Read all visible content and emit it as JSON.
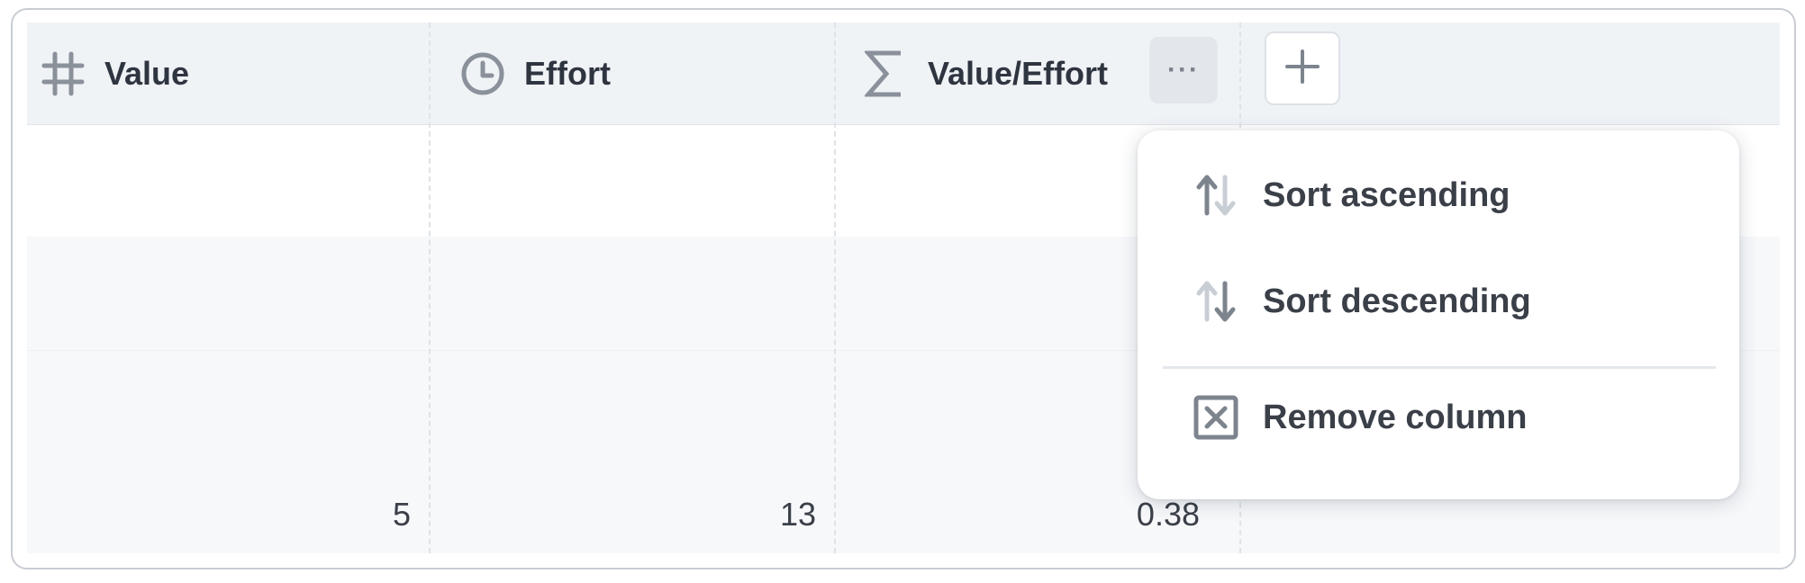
{
  "columns": [
    {
      "icon": "hash-icon",
      "label": "Value"
    },
    {
      "icon": "clock-icon",
      "label": "Effort"
    },
    {
      "icon": "sigma-icon",
      "label": "Value/Effort"
    }
  ],
  "header_actions": {
    "more_label": "···",
    "add_icon": "plus-icon"
  },
  "rows": [
    {
      "value": "",
      "effort": "",
      "ratio": ""
    },
    {
      "value": "",
      "effort": "",
      "ratio": ""
    },
    {
      "value": "",
      "effort": "",
      "ratio": ""
    },
    {
      "value": "5",
      "effort": "13",
      "ratio": "0.38"
    }
  ],
  "column_menu": {
    "items": [
      {
        "icon": "sort-ascending-icon",
        "label": "Sort ascending"
      },
      {
        "icon": "sort-descending-icon",
        "label": "Sort descending"
      },
      {
        "icon": "remove-column-icon",
        "label": "Remove column"
      }
    ]
  },
  "colors": {
    "header_bg": "#f0f3f6",
    "icon_gray": "#8a919b",
    "text_dark": "#2f3540"
  }
}
